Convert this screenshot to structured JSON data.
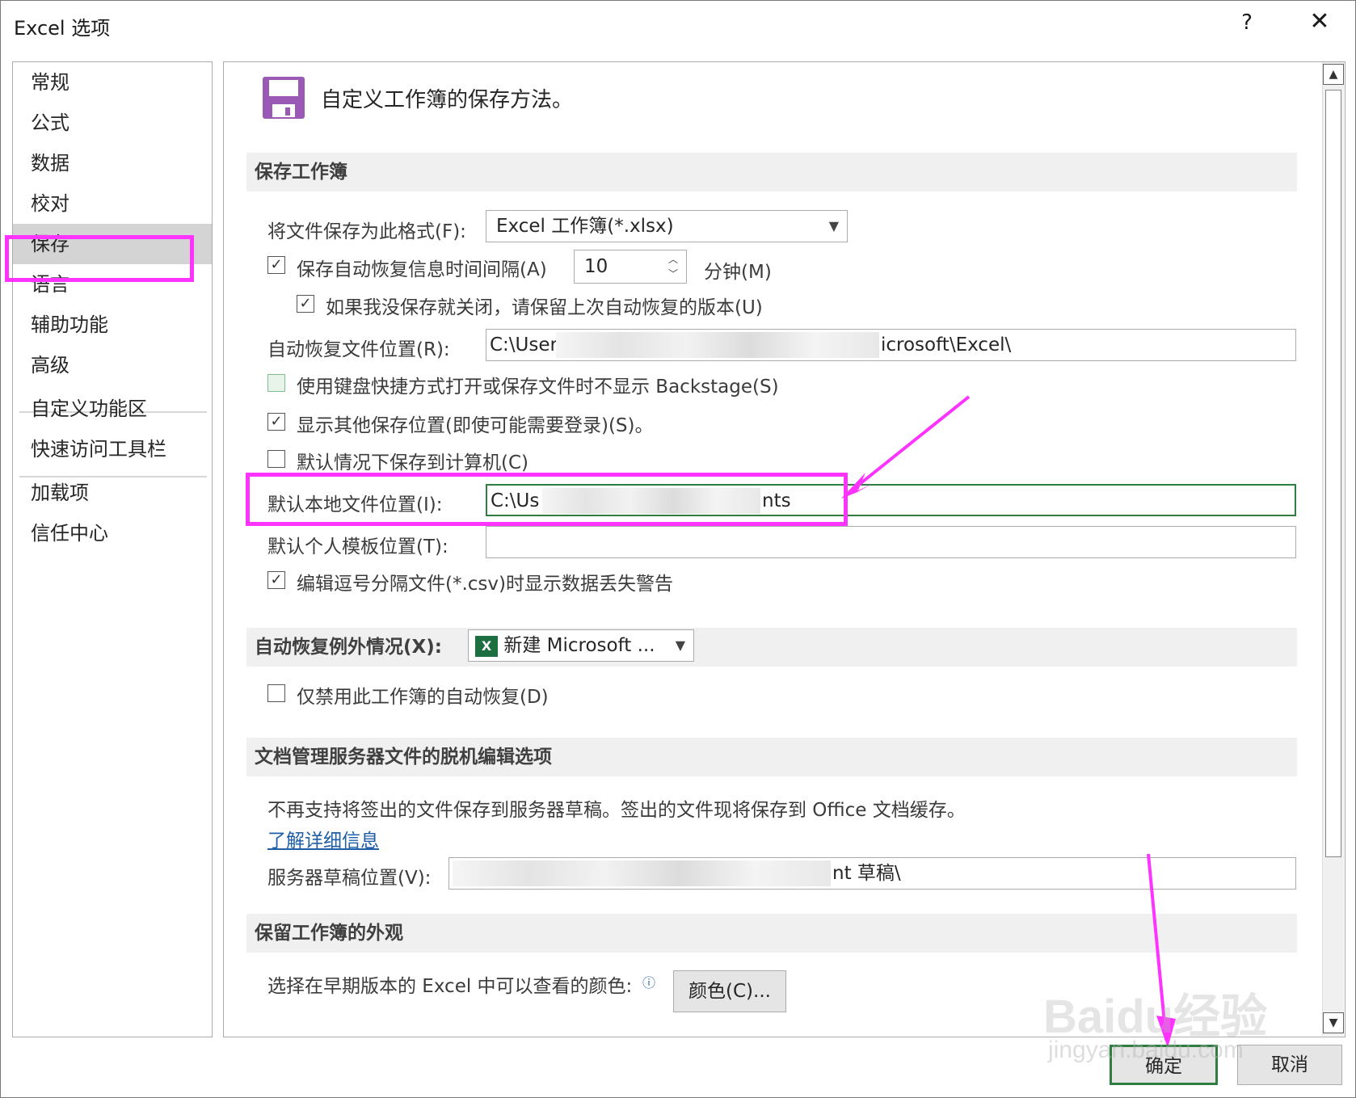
{
  "window": {
    "title": "Excel 选项",
    "help": "?",
    "close": "✕"
  },
  "nav": {
    "items": [
      "常规",
      "公式",
      "数据",
      "校对",
      "保存",
      "语言",
      "辅助功能",
      "高级",
      "自定义功能区",
      "快速访问工具栏",
      "加载项",
      "信任中心"
    ],
    "selected": "保存"
  },
  "header": {
    "text": "自定义工作簿的保存方法。"
  },
  "save_workbooks": {
    "title": "保存工作簿",
    "format_label": "将文件保存为此格式(F):",
    "format_label_key": "F",
    "format_value": "Excel 工作簿(*.xlsx)",
    "autorecover_interval_label": "保存自动恢复信息时间间隔(A)",
    "autorecover_interval_value": "10",
    "minutes_label": "分钟(M)",
    "keep_last_label": "如果我没保存就关闭，请保留上次自动恢复的版本(U)",
    "autorecover_location_label": "自动恢复文件位置(R):",
    "autorecover_location_start": "C:\\User",
    "autorecover_location_end": "icrosoft\\Excel\\",
    "no_backstage_label": "使用键盘快捷方式打开或保存文件时不显示 Backstage(S)",
    "show_other_locations_label": "显示其他保存位置(即使可能需要登录)(S)。",
    "save_to_computer_label": "默认情况下保存到计算机(C)",
    "default_local_label": "默认本地文件位置(I):",
    "default_local_start": "C:\\Us",
    "default_local_end": "nts",
    "personal_template_label": "默认个人模板位置(T):",
    "personal_template_value": "",
    "csv_warning_label": "编辑逗号分隔文件(*.csv)时显示数据丢失警告"
  },
  "autorecover_exceptions": {
    "title": "自动恢复例外情况(X):",
    "workbook_value": "新建 Microsoft ...",
    "disable_label": "仅禁用此工作簿的自动恢复(D)"
  },
  "offline_editing": {
    "title": "文档管理服务器文件的脱机编辑选项",
    "notice": "不再支持将签出的文件保存到服务器草稿。签出的文件现将保存到 Office 文档缓存。",
    "learn_more": "了解详细信息",
    "drafts_label": "服务器草稿位置(V):",
    "drafts_end": "nt 草稿\\"
  },
  "preserve_visual": {
    "title": "保留工作簿的外观",
    "colors_label": "选择在早期版本的 Excel 中可以查看的颜色:",
    "colors_button": "颜色(C)..."
  },
  "footer": {
    "ok": "确定",
    "cancel": "取消"
  },
  "watermark": {
    "brand": "Baidu经验",
    "url": "jingyan.baidu.com"
  },
  "colors": {
    "annotation": "#ff33ff",
    "focus_green": "#2f7d3f",
    "save_icon_purple": "#9b59b6",
    "link_blue": "#1f5fa8"
  }
}
